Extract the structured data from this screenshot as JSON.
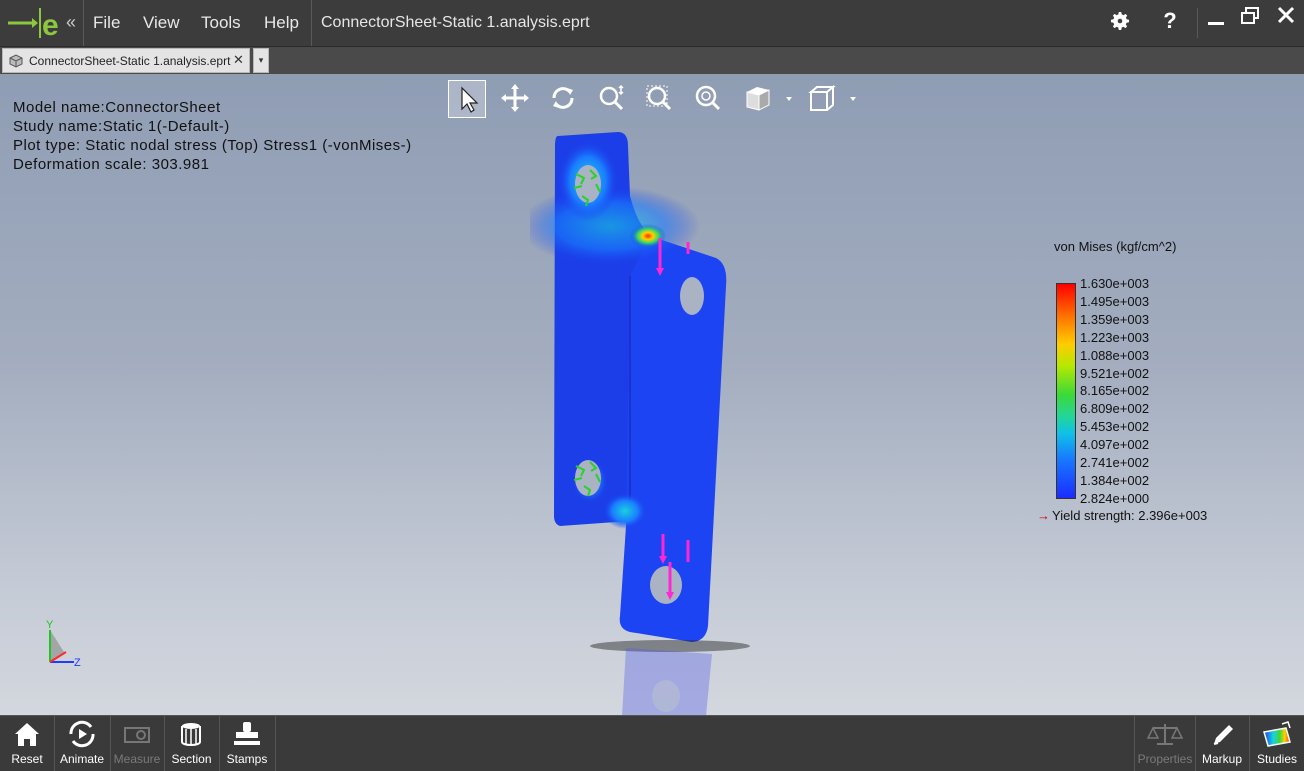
{
  "menu": {
    "file": "File",
    "view": "View",
    "tools": "Tools",
    "help": "Help"
  },
  "window": {
    "title": "ConnectorSheet-Static 1.analysis.eprt"
  },
  "tab": {
    "label": "ConnectorSheet-Static 1.analysis.eprt",
    "close": "✕",
    "dropdown": "▾"
  },
  "info": {
    "model": "Model name:ConnectorSheet",
    "study": "Study name:Static 1(-Default-)",
    "plot": "Plot type: Static nodal stress (Top) Stress1 (-vonMises-)",
    "deformation": "Deformation scale: 303.981"
  },
  "legend": {
    "title": "von Mises (kgf/cm^2)",
    "ticks": [
      "1.630e+003",
      "1.495e+003",
      "1.359e+003",
      "1.223e+003",
      "1.088e+003",
      "9.521e+002",
      "8.165e+002",
      "6.809e+002",
      "5.453e+002",
      "4.097e+002",
      "2.741e+002",
      "1.384e+002",
      "2.824e+000"
    ],
    "yield": "Yield strength: 2.396e+003"
  },
  "triad": {
    "y": "Y",
    "z": "Z"
  },
  "bottom": {
    "reset": "Reset",
    "animate": "Animate",
    "measure": "Measure",
    "section": "Section",
    "stamps": "Stamps",
    "properties": "Properties",
    "markup": "Markup",
    "studies": "Studies"
  },
  "colors": {
    "accent": "#8dc63f",
    "titlebar": "#3c3c3c"
  }
}
